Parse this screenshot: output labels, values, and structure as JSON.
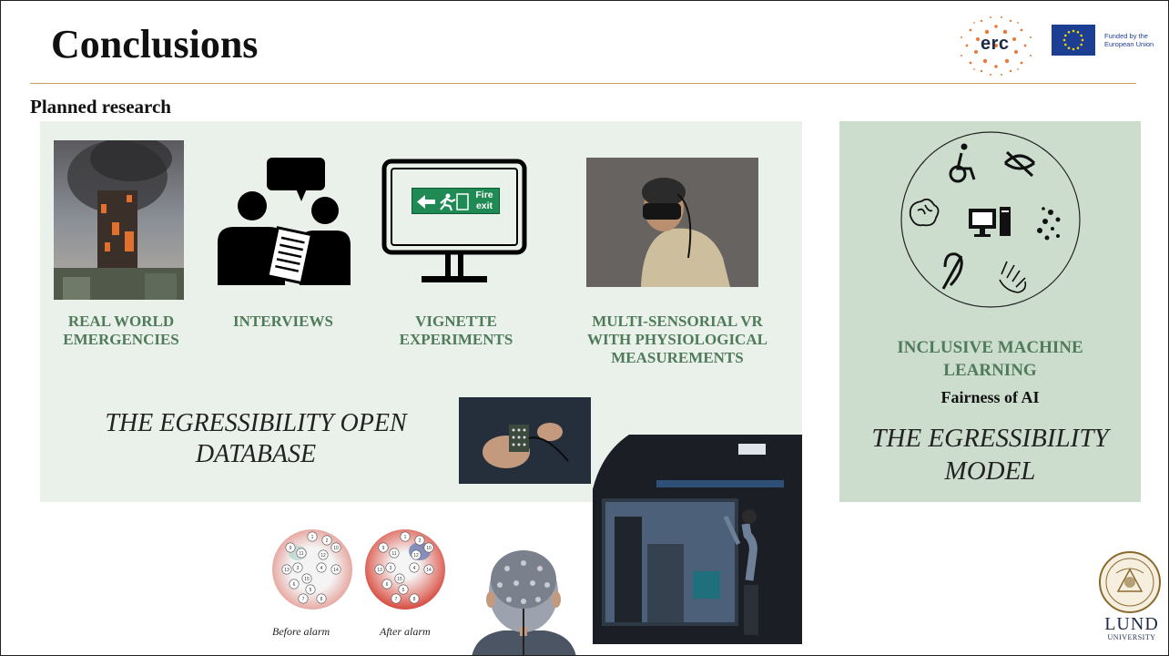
{
  "slide": {
    "title": "Conclusions",
    "subtitle": "Planned research"
  },
  "logos": {
    "erc": "erc",
    "eu_text": [
      "Funded by the",
      "European Union"
    ],
    "lund_name": "LUND",
    "lund_sub": "UNIVERSITY"
  },
  "research_items": [
    {
      "label_lines": [
        "REAL WORLD",
        "EMERGENCIES"
      ]
    },
    {
      "label_lines": [
        "INTERVIEWS"
      ]
    },
    {
      "label_lines": [
        "VIGNETTE",
        "EXPERIMENTS"
      ]
    },
    {
      "label_lines": [
        "MULTI-SENSORIAL VR",
        "WITH PHYSIOLOGICAL",
        "MEASUREMENTS"
      ]
    }
  ],
  "sign": {
    "text_line1": "Fire",
    "text_line2": "exit"
  },
  "database": {
    "title_lines": [
      "THE EGRESSIBILITY OPEN",
      "DATABASE"
    ]
  },
  "model_panel": {
    "heading_lines": [
      "INCLUSIVE MACHINE",
      "LEARNING"
    ],
    "sub": "Fairness of AI",
    "model_lines": [
      "THE EGRESSIBILITY",
      "MODEL"
    ]
  },
  "eeg": {
    "before_caption": "Before alarm",
    "after_caption": "After alarm",
    "electrodes": [
      "1",
      "2",
      "9",
      "10",
      "11",
      "12",
      "13",
      "3",
      "4",
      "14",
      "15",
      "5",
      "6",
      "7",
      "8"
    ]
  },
  "colors": {
    "accent_green": "#4f7b5a",
    "panel_left": "#eaf0ea",
    "panel_right": "#ccddce",
    "rule_gold": "#c8a45a",
    "exit_sign": "#1f8a54"
  }
}
